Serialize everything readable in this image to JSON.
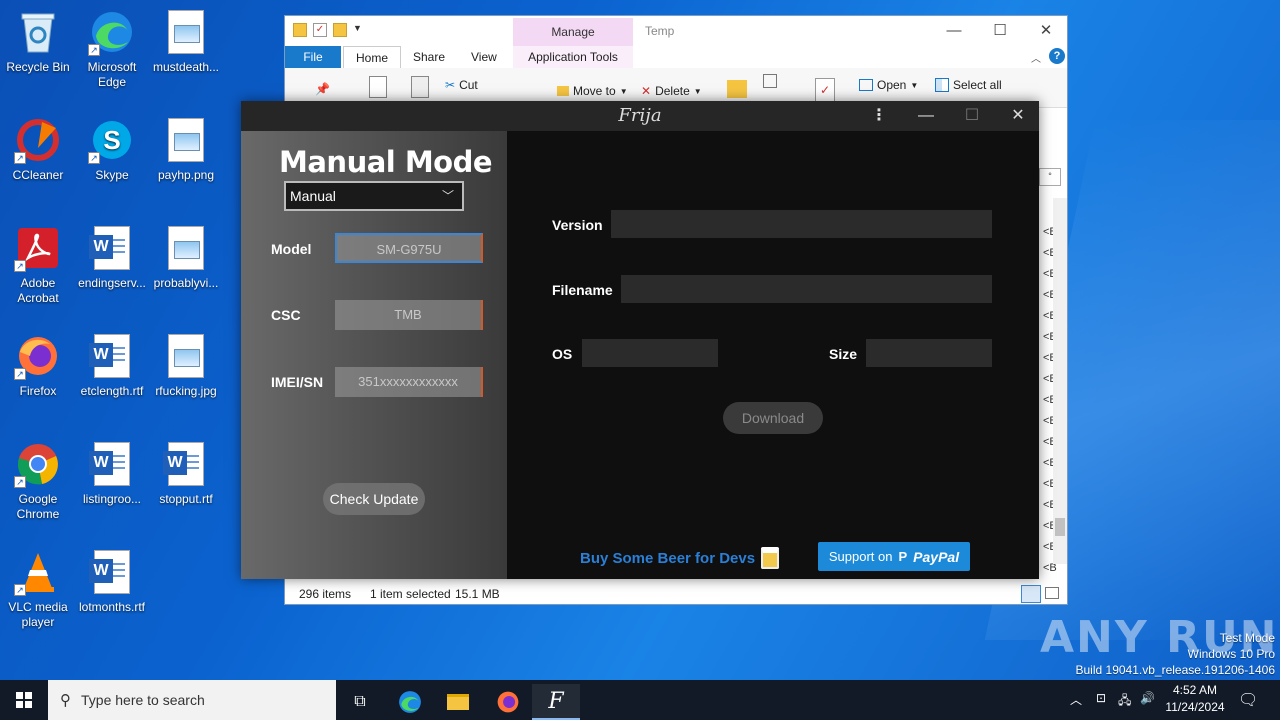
{
  "desktop": {
    "icons": [
      {
        "label": "Recycle Bin",
        "icon": "recycle-bin-icon"
      },
      {
        "label": "Microsoft Edge",
        "icon": "edge-icon"
      },
      {
        "label": "mustdeath...",
        "icon": "image-file-icon"
      },
      {
        "label": "CCleaner",
        "icon": "ccleaner-icon"
      },
      {
        "label": "Skype",
        "icon": "skype-icon"
      },
      {
        "label": "payhp.png",
        "icon": "image-file-icon"
      },
      {
        "label": "Adobe Acrobat",
        "icon": "acrobat-icon"
      },
      {
        "label": "endingserv...",
        "icon": "word-file-icon"
      },
      {
        "label": "probablyvi...",
        "icon": "image-file-icon"
      },
      {
        "label": "Firefox",
        "icon": "firefox-icon"
      },
      {
        "label": "etclength.rtf",
        "icon": "word-file-icon"
      },
      {
        "label": "rfucking.jpg",
        "icon": "image-file-icon"
      },
      {
        "label": "Google Chrome",
        "icon": "chrome-icon"
      },
      {
        "label": "listingroo...",
        "icon": "word-file-icon"
      },
      {
        "label": "stopput.rtf",
        "icon": "word-file-icon"
      },
      {
        "label": "VLC media player",
        "icon": "vlc-icon"
      },
      {
        "label": "lotmonths.rtf",
        "icon": "word-file-icon"
      }
    ]
  },
  "explorer": {
    "title": "Temp",
    "manage_tab": "Manage",
    "tabs": {
      "file": "File",
      "home": "Home",
      "share": "Share",
      "view": "View",
      "app_tools": "Application Tools"
    },
    "ribbon": {
      "cut": "Cut",
      "move_to": "Move to",
      "delete": "Delete",
      "open": "Open",
      "select_all": "Select all"
    },
    "size_col_letters": [
      "<B",
      "<B",
      "<B",
      "<B",
      "<B",
      "<B",
      "<B",
      "<B",
      "<B",
      "<B",
      "<B",
      "<B",
      "<B",
      "<B",
      "<B",
      "<B",
      "<B"
    ],
    "status": {
      "items": "296 items",
      "selected": "1 item selected",
      "size": "15.1 MB"
    }
  },
  "frija": {
    "title": "Frija",
    "heading": "Manual Mode",
    "mode_select": "Manual",
    "model_label": "Model",
    "model_value": "SM-G975U",
    "csc_label": "CSC",
    "csc_value": "TMB",
    "imei_label": "IMEI/SN",
    "imei_value": "351xxxxxxxxxxxx",
    "check_update": "Check Update",
    "version_label": "Version",
    "filename_label": "Filename",
    "os_label": "OS",
    "size_label": "Size",
    "download": "Download",
    "beer_text": "Buy Some Beer for Devs",
    "support_text": "Support on",
    "paypal_text": "PayPal"
  },
  "taskbar": {
    "search_placeholder": "Type here to search",
    "time": "4:52 AM",
    "date": "11/24/2024"
  },
  "watermark": {
    "brand": "ANY RUN",
    "test_mode": "Test Mode",
    "edition": "Windows 10 Pro",
    "build": "Build 19041.vb_release.191206-1406"
  },
  "colors": {
    "desktop_bg": "#0b63d0",
    "frija_accent": "#3d86d6",
    "paypal": "#1c8ad8",
    "beer_text": "#2a7fd6"
  }
}
